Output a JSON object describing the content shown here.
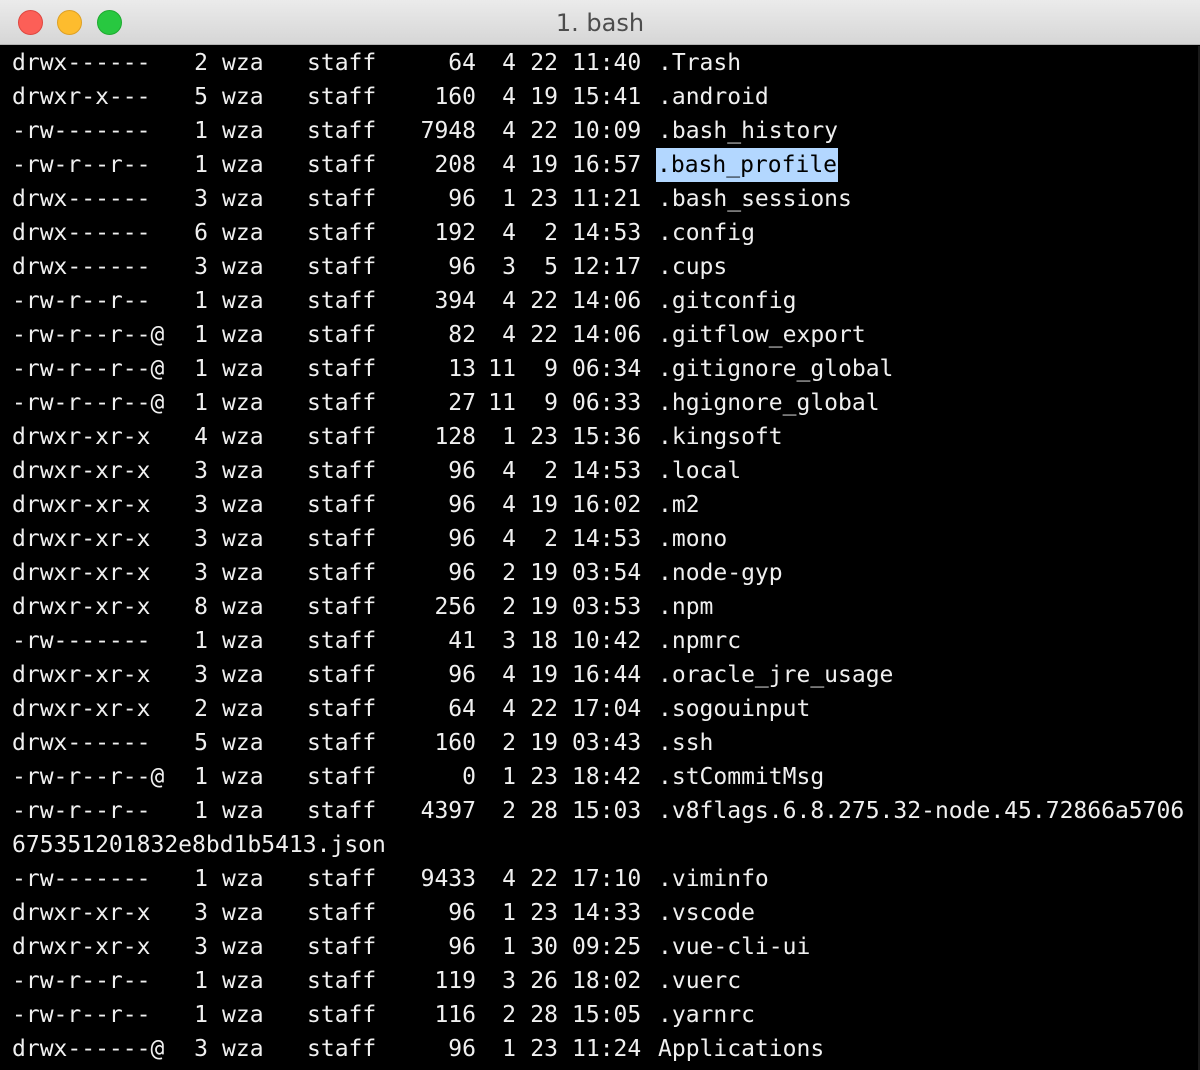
{
  "window": {
    "title": "1. bash"
  },
  "listing": [
    {
      "perm": "drwx------",
      "links": "2",
      "owner": "wza",
      "group": "staff",
      "size": "64",
      "month": "4",
      "day": "22",
      "time": "11:40",
      "name": ".Trash"
    },
    {
      "perm": "drwxr-x---",
      "links": "5",
      "owner": "wza",
      "group": "staff",
      "size": "160",
      "month": "4",
      "day": "19",
      "time": "15:41",
      "name": ".android"
    },
    {
      "perm": "-rw-------",
      "links": "1",
      "owner": "wza",
      "group": "staff",
      "size": "7948",
      "month": "4",
      "day": "22",
      "time": "10:09",
      "name": ".bash_history"
    },
    {
      "perm": "-rw-r--r--",
      "links": "1",
      "owner": "wza",
      "group": "staff",
      "size": "208",
      "month": "4",
      "day": "19",
      "time": "16:57",
      "name": ".bash_profile",
      "selected": true
    },
    {
      "perm": "drwx------",
      "links": "3",
      "owner": "wza",
      "group": "staff",
      "size": "96",
      "month": "1",
      "day": "23",
      "time": "11:21",
      "name": ".bash_sessions"
    },
    {
      "perm": "drwx------",
      "links": "6",
      "owner": "wza",
      "group": "staff",
      "size": "192",
      "month": "4",
      "day": "2",
      "time": "14:53",
      "name": ".config"
    },
    {
      "perm": "drwx------",
      "links": "3",
      "owner": "wza",
      "group": "staff",
      "size": "96",
      "month": "3",
      "day": "5",
      "time": "12:17",
      "name": ".cups"
    },
    {
      "perm": "-rw-r--r--",
      "links": "1",
      "owner": "wza",
      "group": "staff",
      "size": "394",
      "month": "4",
      "day": "22",
      "time": "14:06",
      "name": ".gitconfig"
    },
    {
      "perm": "-rw-r--r--@",
      "links": "1",
      "owner": "wza",
      "group": "staff",
      "size": "82",
      "month": "4",
      "day": "22",
      "time": "14:06",
      "name": ".gitflow_export"
    },
    {
      "perm": "-rw-r--r--@",
      "links": "1",
      "owner": "wza",
      "group": "staff",
      "size": "13",
      "month": "11",
      "day": "9",
      "time": "06:34",
      "name": ".gitignore_global"
    },
    {
      "perm": "-rw-r--r--@",
      "links": "1",
      "owner": "wza",
      "group": "staff",
      "size": "27",
      "month": "11",
      "day": "9",
      "time": "06:33",
      "name": ".hgignore_global"
    },
    {
      "perm": "drwxr-xr-x",
      "links": "4",
      "owner": "wza",
      "group": "staff",
      "size": "128",
      "month": "1",
      "day": "23",
      "time": "15:36",
      "name": ".kingsoft"
    },
    {
      "perm": "drwxr-xr-x",
      "links": "3",
      "owner": "wza",
      "group": "staff",
      "size": "96",
      "month": "4",
      "day": "2",
      "time": "14:53",
      "name": ".local"
    },
    {
      "perm": "drwxr-xr-x",
      "links": "3",
      "owner": "wza",
      "group": "staff",
      "size": "96",
      "month": "4",
      "day": "19",
      "time": "16:02",
      "name": ".m2"
    },
    {
      "perm": "drwxr-xr-x",
      "links": "3",
      "owner": "wza",
      "group": "staff",
      "size": "96",
      "month": "4",
      "day": "2",
      "time": "14:53",
      "name": ".mono"
    },
    {
      "perm": "drwxr-xr-x",
      "links": "3",
      "owner": "wza",
      "group": "staff",
      "size": "96",
      "month": "2",
      "day": "19",
      "time": "03:54",
      "name": ".node-gyp"
    },
    {
      "perm": "drwxr-xr-x",
      "links": "8",
      "owner": "wza",
      "group": "staff",
      "size": "256",
      "month": "2",
      "day": "19",
      "time": "03:53",
      "name": ".npm"
    },
    {
      "perm": "-rw-------",
      "links": "1",
      "owner": "wza",
      "group": "staff",
      "size": "41",
      "month": "3",
      "day": "18",
      "time": "10:42",
      "name": ".npmrc"
    },
    {
      "perm": "drwxr-xr-x",
      "links": "3",
      "owner": "wza",
      "group": "staff",
      "size": "96",
      "month": "4",
      "day": "19",
      "time": "16:44",
      "name": ".oracle_jre_usage"
    },
    {
      "perm": "drwxr-xr-x",
      "links": "2",
      "owner": "wza",
      "group": "staff",
      "size": "64",
      "month": "4",
      "day": "22",
      "time": "17:04",
      "name": ".sogouinput"
    },
    {
      "perm": "drwx------",
      "links": "5",
      "owner": "wza",
      "group": "staff",
      "size": "160",
      "month": "2",
      "day": "19",
      "time": "03:43",
      "name": ".ssh"
    },
    {
      "perm": "-rw-r--r--@",
      "links": "1",
      "owner": "wza",
      "group": "staff",
      "size": "0",
      "month": "1",
      "day": "23",
      "time": "18:42",
      "name": ".stCommitMsg"
    },
    {
      "perm": "-rw-r--r--",
      "links": "1",
      "owner": "wza",
      "group": "staff",
      "size": "4397",
      "month": "2",
      "day": "28",
      "time": "15:03",
      "name": ".v8flags.6.8.275.32-node.45.72866a5706",
      "continuation": "675351201832e8bd1b5413.json"
    },
    {
      "perm": "-rw-------",
      "links": "1",
      "owner": "wza",
      "group": "staff",
      "size": "9433",
      "month": "4",
      "day": "22",
      "time": "17:10",
      "name": ".viminfo"
    },
    {
      "perm": "drwxr-xr-x",
      "links": "3",
      "owner": "wza",
      "group": "staff",
      "size": "96",
      "month": "1",
      "day": "23",
      "time": "14:33",
      "name": ".vscode"
    },
    {
      "perm": "drwxr-xr-x",
      "links": "3",
      "owner": "wza",
      "group": "staff",
      "size": "96",
      "month": "1",
      "day": "30",
      "time": "09:25",
      "name": ".vue-cli-ui"
    },
    {
      "perm": "-rw-r--r--",
      "links": "1",
      "owner": "wza",
      "group": "staff",
      "size": "119",
      "month": "3",
      "day": "26",
      "time": "18:02",
      "name": ".vuerc"
    },
    {
      "perm": "-rw-r--r--",
      "links": "1",
      "owner": "wza",
      "group": "staff",
      "size": "116",
      "month": "2",
      "day": "28",
      "time": "15:05",
      "name": ".yarnrc"
    },
    {
      "perm": "drwx------@",
      "links": "3",
      "owner": "wza",
      "group": "staff",
      "size": "96",
      "month": "1",
      "day": "23",
      "time": "11:24",
      "name": "Applications"
    }
  ]
}
